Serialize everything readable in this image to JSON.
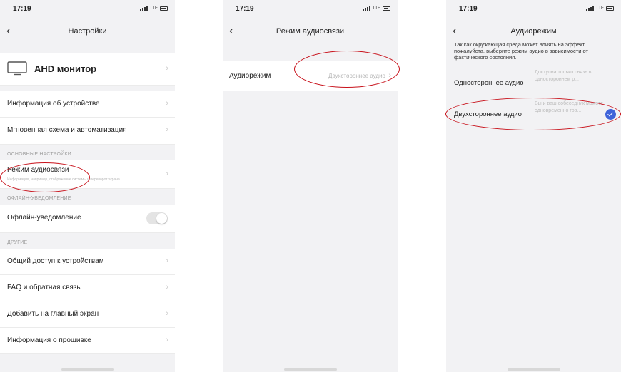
{
  "status": {
    "time": "17:19",
    "network": "LTE"
  },
  "screen1": {
    "title": "Настройки",
    "device_name": "AHD монитор",
    "top_items": [
      "Информация об устройстве",
      "Мгновенная схема и автоматизация"
    ],
    "section_basic": "ОСНОВНЫЕ НАСТРОЙКИ",
    "audio_label": "Режим аудиосвязи",
    "audio_sub": "Информация, например, отображение системы и переворот экрана",
    "section_offline": "ОФЛАЙН-УВЕДОМЛЕНИЕ",
    "offline_label": "Офлайн-уведомление",
    "offline_toggle": "off",
    "section_other": "ДРУГИЕ",
    "other_items": [
      "Общий доступ к устройствам",
      "FAQ и обратная связь",
      "Добавить на главный экран",
      "Информация о прошивке"
    ]
  },
  "screen2": {
    "title": "Режим аудиосвязи",
    "row_label": "Аудиорежим",
    "row_value": "Двухстороннее аудио"
  },
  "screen3": {
    "title": "Аудиорежим",
    "info": "Так как окружающая среда может влиять на эффект, пожалуйста, выберите режим аудио в зависимости от фактического состояния.",
    "options": [
      {
        "label": "Одностороннее аудио",
        "desc": "Доступна только связь в одностороннем р...",
        "selected": false
      },
      {
        "label": "Двухстороннее аудио",
        "desc": "Вы и ваш собеседник можете одновременно гов...",
        "selected": true
      }
    ]
  },
  "colors": {
    "accent": "#3f63d9",
    "highlight_ring": "#c8121b",
    "background": "#f2f2f4"
  }
}
